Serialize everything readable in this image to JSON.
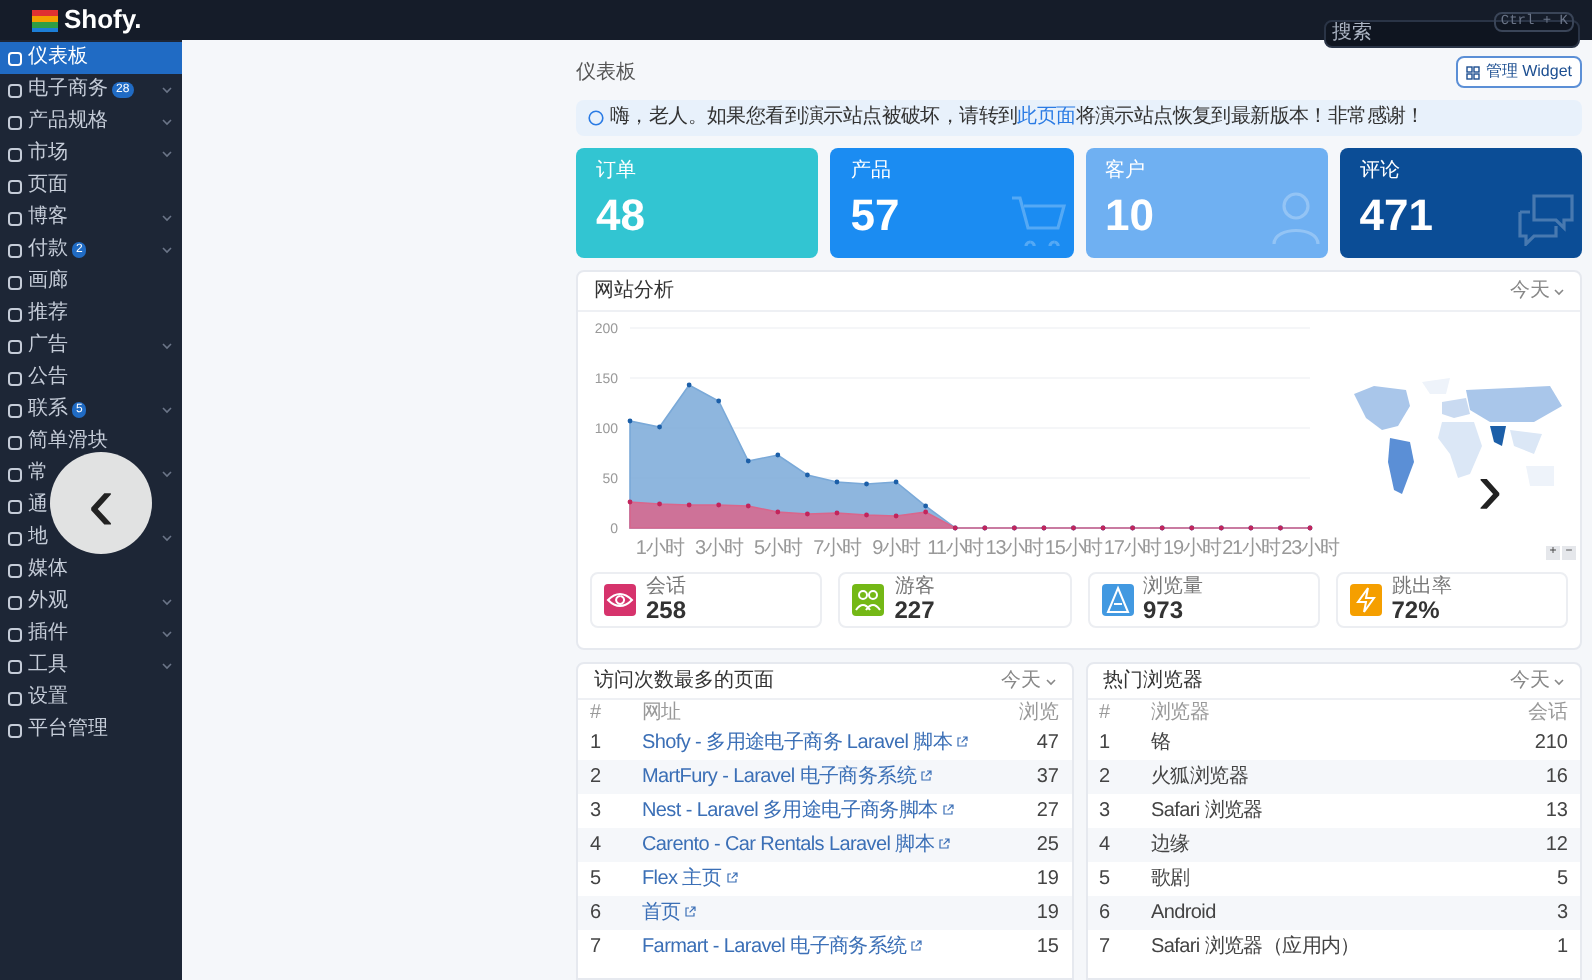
{
  "topbar": {
    "logo": "Shofy.",
    "search": {
      "placeholder": "搜索",
      "shortcut": "Ctrl + K"
    }
  },
  "sidebar": {
    "items": [
      {
        "label": "仪表板",
        "selected": true,
        "has_submenu": false
      },
      {
        "label": "电子商务",
        "selected": false,
        "has_submenu": true,
        "badge": "28"
      },
      {
        "label": "产品规格",
        "selected": false,
        "has_submenu": true
      },
      {
        "label": "市场",
        "selected": false,
        "has_submenu": true
      },
      {
        "label": "页面",
        "selected": false,
        "has_submenu": false
      },
      {
        "label": "博客",
        "selected": false,
        "has_submenu": true
      },
      {
        "label": "付款",
        "selected": false,
        "has_submenu": true,
        "badge": "2"
      },
      {
        "label": "画廊",
        "selected": false,
        "has_submenu": false
      },
      {
        "label": "推荐",
        "selected": false,
        "has_submenu": false
      },
      {
        "label": "广告",
        "selected": false,
        "has_submenu": true
      },
      {
        "label": "公告",
        "selected": false,
        "has_submenu": false
      },
      {
        "label": "联系",
        "selected": false,
        "has_submenu": true,
        "badge": "5"
      },
      {
        "label": "简单滑块",
        "selected": false,
        "has_submenu": false
      },
      {
        "label": "常",
        "selected": false,
        "has_submenu": true
      },
      {
        "label": "通",
        "selected": false,
        "has_submenu": false
      },
      {
        "label": "地",
        "selected": false,
        "has_submenu": true
      },
      {
        "label": "媒体",
        "selected": false,
        "has_submenu": false
      },
      {
        "label": "外观",
        "selected": false,
        "has_submenu": true
      },
      {
        "label": "插件",
        "selected": false,
        "has_submenu": true
      },
      {
        "label": "工具",
        "selected": false,
        "has_submenu": true
      },
      {
        "label": "设置",
        "selected": false,
        "has_submenu": false
      },
      {
        "label": "平台管理",
        "selected": false,
        "has_submenu": false
      }
    ]
  },
  "breadcrumb": "仪表板",
  "manage_button": "管理 Widget",
  "alert": "嗨，老人。如果您看到演示站点被破坏，请转到**此页面**将演示站点恢复到最新版本！非常感谢！",
  "cards": [
    {
      "label": "订单",
      "value": "48",
      "color": "#32c5d2"
    },
    {
      "label": "产品",
      "value": "57",
      "color": "#1b8cf2"
    },
    {
      "label": "客户",
      "value": "10",
      "color": "#6fb0f2"
    },
    {
      "label": "评论",
      "value": "471",
      "color": "#0b4d96"
    }
  ],
  "analytics": {
    "title": "网站分析",
    "period": "今天",
    "chart_data": {
      "type": "area",
      "grid": true,
      "x": [
        0,
        1,
        2,
        3,
        4,
        5,
        6,
        7,
        8,
        9,
        10,
        11,
        12,
        13,
        14,
        15,
        16,
        17,
        18,
        19,
        20,
        21,
        22,
        23
      ],
      "xlim": [
        0,
        23
      ],
      "xticks": [
        {
          "value": 1,
          "label": "1小时"
        },
        {
          "value": 3,
          "label": "3小时"
        },
        {
          "value": 5,
          "label": "5小时"
        },
        {
          "value": 7,
          "label": "7小时"
        },
        {
          "value": 9,
          "label": "9小时"
        },
        {
          "value": 11,
          "label": "11小时"
        },
        {
          "value": 13,
          "label": "13小时"
        },
        {
          "value": 15,
          "label": "15小时"
        },
        {
          "value": 17,
          "label": "17小时"
        },
        {
          "value": 19,
          "label": "19小时"
        },
        {
          "value": 21,
          "label": "21小时"
        },
        {
          "value": 23,
          "label": "23小时"
        }
      ],
      "yticks": [
        0,
        50,
        100,
        150,
        200
      ],
      "ylim": [
        0,
        200
      ],
      "series": [
        {
          "color": "#7aa9d8",
          "values": [
            107,
            101,
            143,
            127,
            67,
            73,
            53,
            46,
            44,
            46,
            22,
            0,
            0,
            0,
            0,
            0,
            0,
            0,
            0,
            0,
            0,
            0,
            0,
            0
          ]
        },
        {
          "color": "#d9668c",
          "values": [
            26,
            24,
            23,
            23,
            22,
            16,
            14,
            15,
            13,
            12,
            16,
            0,
            0,
            0,
            0,
            0,
            0,
            0,
            0,
            0,
            0,
            0,
            0,
            0
          ]
        }
      ]
    },
    "map_zoom": [
      "+",
      "−"
    ],
    "stats": [
      {
        "label": "会话",
        "value": "258",
        "color": "#d6336c"
      },
      {
        "label": "游客",
        "value": "227",
        "color": "#74b816"
      },
      {
        "label": "浏览量",
        "value": "973",
        "color": "#4299e1"
      },
      {
        "label": "跳出率",
        "value": "72%",
        "color": "#f59f00"
      }
    ]
  },
  "tables": [
    {
      "title": "访问次数最多的页面",
      "period": "今天",
      "columns": [
        "#",
        "网址",
        "浏览"
      ],
      "rows": [
        [
          "1",
          "Shofy - 多用途电子商务 Laravel 脚本",
          "47"
        ],
        [
          "2",
          "MartFury - Laravel 电子商务系统",
          "37"
        ],
        [
          "3",
          "Nest - Laravel 多用途电子商务脚本",
          "27"
        ],
        [
          "4",
          "Carento - Car Rentals Laravel 脚本",
          "25"
        ],
        [
          "5",
          "Flex 主页",
          "19"
        ],
        [
          "6",
          "首页",
          "19"
        ],
        [
          "7",
          "Farmart - Laravel 电子商务系统",
          "15"
        ]
      ]
    },
    {
      "title": "热门浏览器",
      "period": "今天",
      "columns": [
        "#",
        "浏览器",
        "会话"
      ],
      "rows": [
        [
          "1",
          "铬",
          "210"
        ],
        [
          "2",
          "火狐浏览器",
          "16"
        ],
        [
          "3",
          "Safari 浏览器",
          "13"
        ],
        [
          "4",
          "边缘",
          "12"
        ],
        [
          "5",
          "歌剧",
          "5"
        ],
        [
          "6",
          "Android",
          "3"
        ],
        [
          "7",
          "Safari 浏览器（应用内）",
          "1"
        ]
      ]
    }
  ],
  "gallery": {
    "previous": "‹",
    "next": "›"
  }
}
